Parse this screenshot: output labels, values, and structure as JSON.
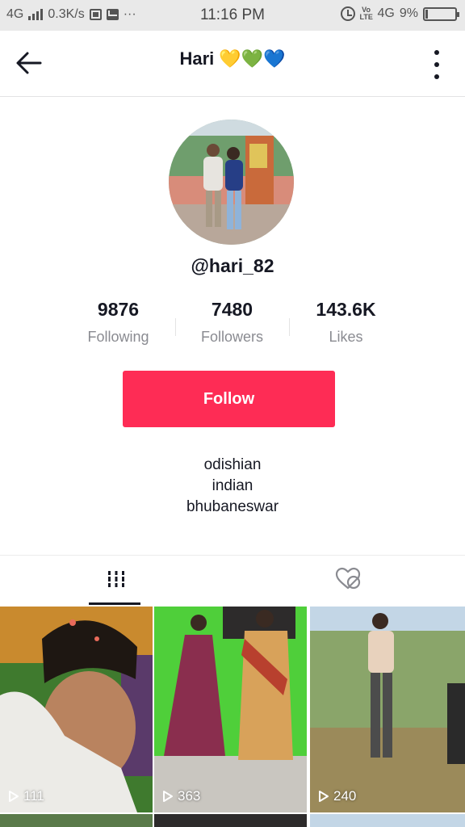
{
  "status_bar": {
    "network": "4G",
    "speed": "0.3K/s",
    "dots": "···",
    "time": "11:16 PM",
    "volte": "Vo LTE",
    "network_right": "4G",
    "battery": "9%",
    "battery_level": 0.09
  },
  "header": {
    "title": "Hari 💛💚💙",
    "back_icon": "arrow-left-icon",
    "more_icon": "more-vertical-icon"
  },
  "profile": {
    "username": "@hari_82",
    "avatar_icon": "profile-photo"
  },
  "stats": [
    {
      "value": "9876",
      "label": "Following"
    },
    {
      "value": "7480",
      "label": "Followers"
    },
    {
      "value": "143.6K",
      "label": "Likes"
    }
  ],
  "follow_button": {
    "label": "Follow",
    "color": "#fe2c55"
  },
  "bio": [
    "odishian",
    "indian",
    "bhubaneswar"
  ],
  "tabs": [
    {
      "name": "videos",
      "icon": "grid-columns-icon",
      "active": true
    },
    {
      "name": "liked",
      "icon": "liked-hidden-icon",
      "active": false
    }
  ],
  "videos": [
    {
      "views": "111"
    },
    {
      "views": "363"
    },
    {
      "views": "240"
    }
  ]
}
